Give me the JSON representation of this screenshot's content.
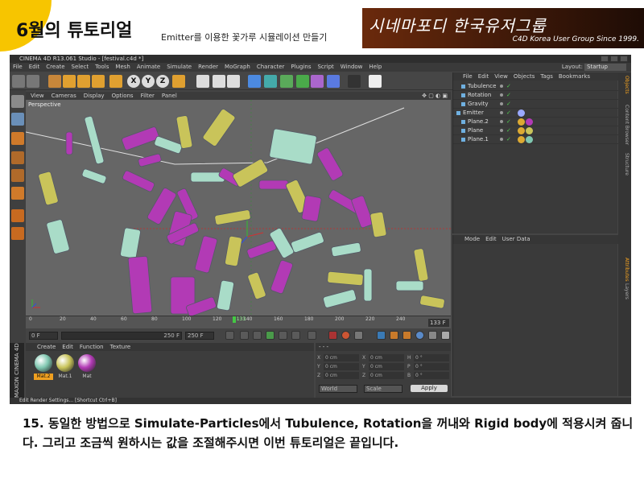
{
  "slide": {
    "title": "6월의 튜토리얼",
    "subtitle": "Emitter를 이용한 꽃가루 시뮬레이션 만들기",
    "banner_hand": "시네마포디 한국유저그룹",
    "banner_en": "C4D Korea User Group Since 1999.",
    "caption_num": "15.",
    "caption_text": "동일한 방법으로 Simulate-Particles에서 Tubulence, Rotation을 꺼내와 Rigid body에 적용시켜 줍니다. 그리고 조금씩 원하시는 값을 조절해주시면 이번 튜토리얼은 끝입니다."
  },
  "app": {
    "window_title": "CINEMA 4D R13.061 Studio - [festival.c4d *]",
    "menu": [
      "File",
      "Edit",
      "Create",
      "Select",
      "Tools",
      "Mesh",
      "Animate",
      "Simulate",
      "Render",
      "MoGraph",
      "Character",
      "Plugins",
      "Script",
      "Window",
      "Help"
    ],
    "layout_label": "Layout:",
    "layout_value": "Startup",
    "toolbar_icons": [
      "undo-icon",
      "redo-icon",
      "select-arrow-icon",
      "move-icon",
      "scale-icon",
      "rotate-icon",
      "model-icon",
      "axis-x-icon",
      "axis-y-icon",
      "axis-z-icon",
      "world-coord-icon",
      "render-view-icon",
      "render-picture-icon",
      "render-settings-icon",
      "cube-icon",
      "pen-icon",
      "subdivision-icon",
      "array-icon",
      "deformer-icon",
      "floor-icon",
      "camera-icon",
      "light-icon"
    ],
    "axis_labels": [
      "X",
      "Y",
      "Z"
    ],
    "viewport": {
      "menu": [
        "View",
        "Cameras",
        "Display",
        "Options",
        "Filter",
        "Panel"
      ],
      "label": "Perspective",
      "icons_label": "✥ ▢ ◐ ▣"
    },
    "timeline": {
      "ticks": [
        "0",
        "20",
        "40",
        "60",
        "80",
        "100",
        "120",
        "140",
        "160",
        "180",
        "200",
        "220",
        "240"
      ],
      "current": "133",
      "end_label": "133 F",
      "cursor_frac": 0.5542
    },
    "transport": {
      "start": "0 F",
      "range_end": "250 F",
      "end": "250 F"
    },
    "materials": {
      "tabs": [
        "Create",
        "Edit",
        "Function",
        "Texture"
      ],
      "items": [
        {
          "name": "Mat.2",
          "color": "#7fc7b0",
          "selected": true
        },
        {
          "name": "Mat.1",
          "color": "#c9c45a",
          "selected": false
        },
        {
          "name": "Mat",
          "color": "#b23ab5",
          "selected": false
        }
      ]
    },
    "maxon_label": "MAXON CINEMA 4D",
    "coords": {
      "rows": [
        {
          "a": "X",
          "av": "0 cm",
          "b": "X",
          "bv": "0 cm",
          "c": "H",
          "cv": "0 °"
        },
        {
          "a": "Y",
          "av": "0 cm",
          "b": "Y",
          "bv": "0 cm",
          "c": "P",
          "cv": "0 °"
        },
        {
          "a": "Z",
          "av": "0 cm",
          "b": "Z",
          "bv": "0 cm",
          "c": "B",
          "cv": "0 °"
        }
      ],
      "mode1": "World",
      "mode2": "Scale",
      "apply": "Apply"
    },
    "status": "Edit Render Settings... [Shortcut Ctrl+B]",
    "objects": {
      "menu": [
        "File",
        "Edit",
        "View",
        "Objects",
        "Tags",
        "Bookmarks"
      ],
      "rows": [
        {
          "name": "Tubulence",
          "indent": 1,
          "tags": []
        },
        {
          "name": "Rotation",
          "indent": 1,
          "tags": []
        },
        {
          "name": "Gravity",
          "indent": 1,
          "tags": []
        },
        {
          "name": "Emitter",
          "indent": 0,
          "tags": [
            "#9aa9ff"
          ]
        },
        {
          "name": "Plane.2",
          "indent": 1,
          "tags": [
            "#ddaa33",
            "#b23ab5"
          ]
        },
        {
          "name": "Plane",
          "indent": 1,
          "tags": [
            "#ddaa33",
            "#c9c45a"
          ]
        },
        {
          "name": "Plane.1",
          "indent": 1,
          "tags": [
            "#ddaa33",
            "#7fc7b0"
          ]
        }
      ]
    },
    "attributes": {
      "menu": [
        "Mode",
        "Edit",
        "User Data"
      ]
    },
    "vertical_tabs": [
      "Objects",
      "Content Browser",
      "Structure",
      "Attributes",
      "Layers"
    ],
    "colors": {
      "magenta": "#b23ab5",
      "yellow": "#c9c45a",
      "mint": "#a9dcc8",
      "frame_green": "#44c844"
    }
  }
}
